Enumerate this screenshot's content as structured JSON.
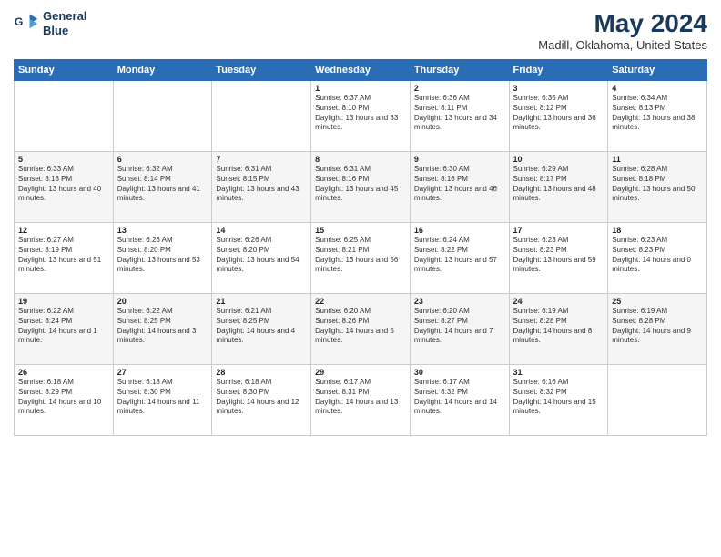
{
  "header": {
    "logo_line1": "General",
    "logo_line2": "Blue",
    "title": "May 2024",
    "subtitle": "Madill, Oklahoma, United States"
  },
  "days_of_week": [
    "Sunday",
    "Monday",
    "Tuesday",
    "Wednesday",
    "Thursday",
    "Friday",
    "Saturday"
  ],
  "weeks": [
    [
      {
        "day": "",
        "info": ""
      },
      {
        "day": "",
        "info": ""
      },
      {
        "day": "",
        "info": ""
      },
      {
        "day": "1",
        "info": "Sunrise: 6:37 AM\nSunset: 8:10 PM\nDaylight: 13 hours and 33 minutes."
      },
      {
        "day": "2",
        "info": "Sunrise: 6:36 AM\nSunset: 8:11 PM\nDaylight: 13 hours and 34 minutes."
      },
      {
        "day": "3",
        "info": "Sunrise: 6:35 AM\nSunset: 8:12 PM\nDaylight: 13 hours and 36 minutes."
      },
      {
        "day": "4",
        "info": "Sunrise: 6:34 AM\nSunset: 8:13 PM\nDaylight: 13 hours and 38 minutes."
      }
    ],
    [
      {
        "day": "5",
        "info": "Sunrise: 6:33 AM\nSunset: 8:13 PM\nDaylight: 13 hours and 40 minutes."
      },
      {
        "day": "6",
        "info": "Sunrise: 6:32 AM\nSunset: 8:14 PM\nDaylight: 13 hours and 41 minutes."
      },
      {
        "day": "7",
        "info": "Sunrise: 6:31 AM\nSunset: 8:15 PM\nDaylight: 13 hours and 43 minutes."
      },
      {
        "day": "8",
        "info": "Sunrise: 6:31 AM\nSunset: 8:16 PM\nDaylight: 13 hours and 45 minutes."
      },
      {
        "day": "9",
        "info": "Sunrise: 6:30 AM\nSunset: 8:16 PM\nDaylight: 13 hours and 46 minutes."
      },
      {
        "day": "10",
        "info": "Sunrise: 6:29 AM\nSunset: 8:17 PM\nDaylight: 13 hours and 48 minutes."
      },
      {
        "day": "11",
        "info": "Sunrise: 6:28 AM\nSunset: 8:18 PM\nDaylight: 13 hours and 50 minutes."
      }
    ],
    [
      {
        "day": "12",
        "info": "Sunrise: 6:27 AM\nSunset: 8:19 PM\nDaylight: 13 hours and 51 minutes."
      },
      {
        "day": "13",
        "info": "Sunrise: 6:26 AM\nSunset: 8:20 PM\nDaylight: 13 hours and 53 minutes."
      },
      {
        "day": "14",
        "info": "Sunrise: 6:26 AM\nSunset: 8:20 PM\nDaylight: 13 hours and 54 minutes."
      },
      {
        "day": "15",
        "info": "Sunrise: 6:25 AM\nSunset: 8:21 PM\nDaylight: 13 hours and 56 minutes."
      },
      {
        "day": "16",
        "info": "Sunrise: 6:24 AM\nSunset: 8:22 PM\nDaylight: 13 hours and 57 minutes."
      },
      {
        "day": "17",
        "info": "Sunrise: 6:23 AM\nSunset: 8:23 PM\nDaylight: 13 hours and 59 minutes."
      },
      {
        "day": "18",
        "info": "Sunrise: 6:23 AM\nSunset: 8:23 PM\nDaylight: 14 hours and 0 minutes."
      }
    ],
    [
      {
        "day": "19",
        "info": "Sunrise: 6:22 AM\nSunset: 8:24 PM\nDaylight: 14 hours and 1 minute."
      },
      {
        "day": "20",
        "info": "Sunrise: 6:22 AM\nSunset: 8:25 PM\nDaylight: 14 hours and 3 minutes."
      },
      {
        "day": "21",
        "info": "Sunrise: 6:21 AM\nSunset: 8:25 PM\nDaylight: 14 hours and 4 minutes."
      },
      {
        "day": "22",
        "info": "Sunrise: 6:20 AM\nSunset: 8:26 PM\nDaylight: 14 hours and 5 minutes."
      },
      {
        "day": "23",
        "info": "Sunrise: 6:20 AM\nSunset: 8:27 PM\nDaylight: 14 hours and 7 minutes."
      },
      {
        "day": "24",
        "info": "Sunrise: 6:19 AM\nSunset: 8:28 PM\nDaylight: 14 hours and 8 minutes."
      },
      {
        "day": "25",
        "info": "Sunrise: 6:19 AM\nSunset: 8:28 PM\nDaylight: 14 hours and 9 minutes."
      }
    ],
    [
      {
        "day": "26",
        "info": "Sunrise: 6:18 AM\nSunset: 8:29 PM\nDaylight: 14 hours and 10 minutes."
      },
      {
        "day": "27",
        "info": "Sunrise: 6:18 AM\nSunset: 8:30 PM\nDaylight: 14 hours and 11 minutes."
      },
      {
        "day": "28",
        "info": "Sunrise: 6:18 AM\nSunset: 8:30 PM\nDaylight: 14 hours and 12 minutes."
      },
      {
        "day": "29",
        "info": "Sunrise: 6:17 AM\nSunset: 8:31 PM\nDaylight: 14 hours and 13 minutes."
      },
      {
        "day": "30",
        "info": "Sunrise: 6:17 AM\nSunset: 8:32 PM\nDaylight: 14 hours and 14 minutes."
      },
      {
        "day": "31",
        "info": "Sunrise: 6:16 AM\nSunset: 8:32 PM\nDaylight: 14 hours and 15 minutes."
      },
      {
        "day": "",
        "info": ""
      }
    ]
  ]
}
